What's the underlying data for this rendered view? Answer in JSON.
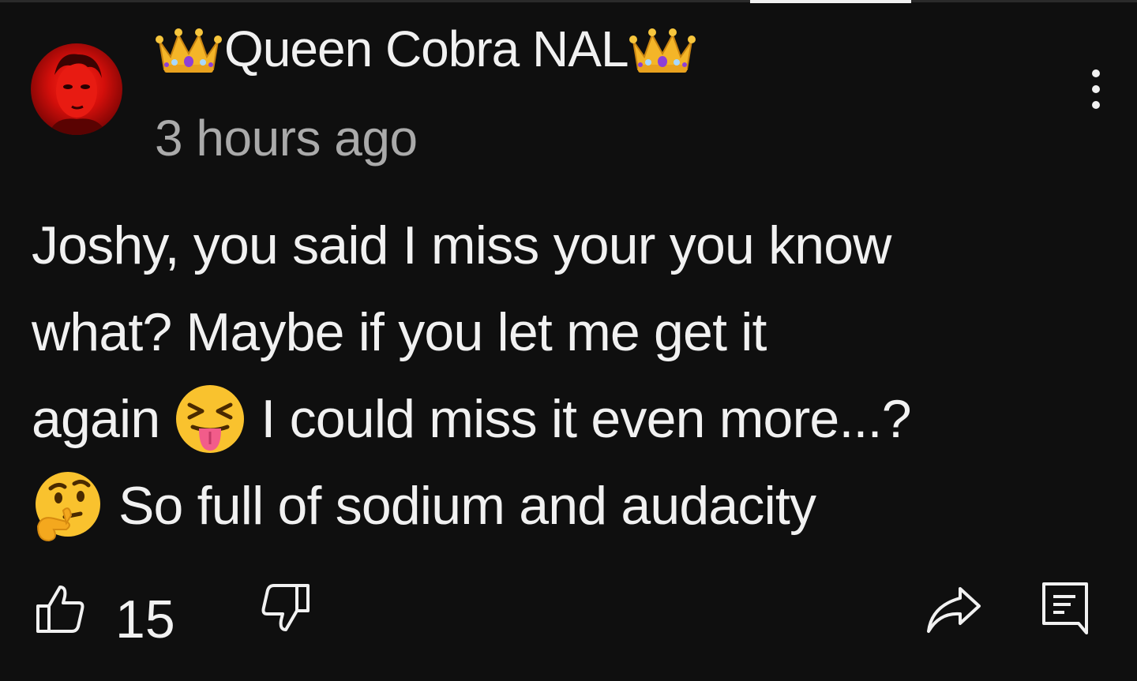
{
  "comment": {
    "author": "Queen Cobra NAL",
    "author_icons": [
      "crown-emoji",
      "crown-emoji"
    ],
    "timestamp": "3 hours ago",
    "lines": [
      {
        "text": "Joshy, you said I miss your you know"
      },
      {
        "text": "what? Maybe if you let me get it"
      },
      {
        "before": "again",
        "emoji": "squinting-face-with-tongue-emoji",
        "after": "I could miss it even more...?"
      },
      {
        "emoji": "thinking-face-emoji",
        "after": "So full of sodium and audacity"
      }
    ],
    "like_count": "15"
  },
  "icons": {
    "more": "more-vertical-icon",
    "like": "thumb-up-icon",
    "dislike": "thumb-down-icon",
    "share": "share-icon",
    "reply": "reply-comment-icon"
  },
  "colors": {
    "background": "#0f0f0f",
    "text_primary": "#f1f1f1",
    "text_secondary": "#aaaaaa"
  }
}
